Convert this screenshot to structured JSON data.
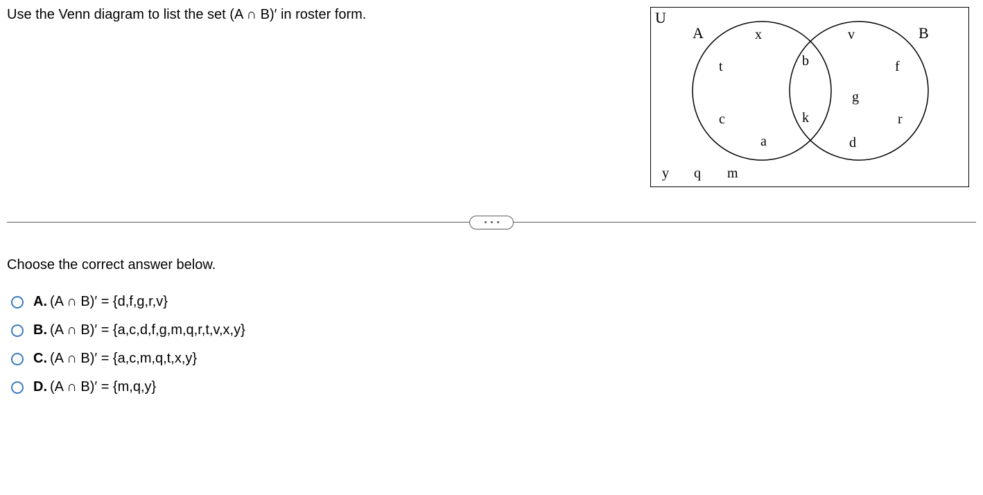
{
  "question": "Use the Venn diagram to list the set (A ∩ B)′ in roster form.",
  "venn": {
    "universe_label": "U",
    "set_a_label": "A",
    "set_b_label": "B",
    "elements": {
      "only_a": [
        "x",
        "t",
        "c",
        "a"
      ],
      "only_b": [
        "v",
        "f",
        "g",
        "r",
        "d"
      ],
      "intersection": [
        "b",
        "k"
      ],
      "outside": [
        "y",
        "q",
        "m"
      ]
    }
  },
  "prompt": "Choose the correct answer below.",
  "options": {
    "a": {
      "letter": "A.",
      "text": "(A ∩ B)′ = {d,f,g,r,v}"
    },
    "b": {
      "letter": "B.",
      "text": "(A ∩ B)′ = {a,c,d,f,g,m,q,r,t,v,x,y}"
    },
    "c": {
      "letter": "C.",
      "text": "(A ∩ B)′ = {a,c,m,q,t,x,y}"
    },
    "d": {
      "letter": "D.",
      "text": "(A ∩ B)′ = {m,q,y}"
    }
  }
}
